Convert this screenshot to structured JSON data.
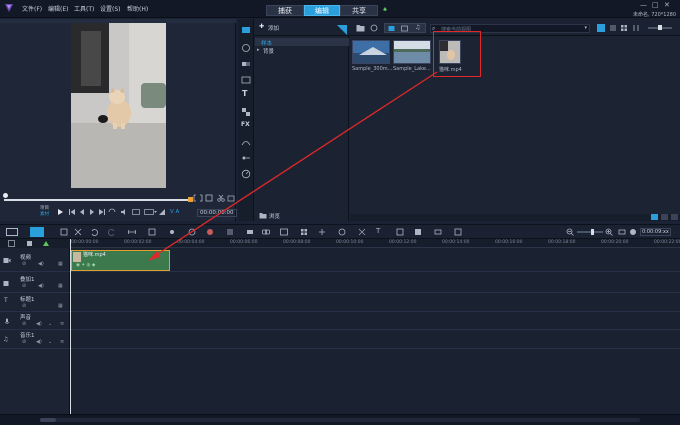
{
  "menu": {
    "items": [
      "文件(F)",
      "编辑(E)",
      "工具(T)",
      "设置(S)",
      "帮助(H)"
    ]
  },
  "tabs": [
    {
      "label": "捕获",
      "active": false
    },
    {
      "label": "编辑",
      "active": true
    },
    {
      "label": "共享",
      "active": false
    }
  ],
  "project_info": "未命名, 720*1280",
  "window_controls": {
    "minimize": "—",
    "maximize": "□",
    "close": "✕"
  },
  "preview": {
    "mode_project": "项目",
    "mode_clip": "素材",
    "timecode": "00:00:00:00",
    "ratio_label": "V A"
  },
  "library": {
    "add_label": "添加",
    "tree_items": [
      "样本",
      "背景"
    ],
    "search_placeholder": "搜索当前视图",
    "browse_label": "浏览",
    "thumbnails": [
      {
        "label": "Sample_300m..."
      },
      {
        "label": "Sample_Lake..."
      },
      {
        "label": "猫咪.mp4",
        "highlighted": true
      }
    ]
  },
  "timeline": {
    "ruler_ticks": [
      "00:00:00:00",
      "00:00:02:00",
      "00:00:04:00",
      "00:00:06:00",
      "00:00:08:00",
      "00:00:10:00",
      "00:00:12:00",
      "00:00:14:00",
      "00:00:16:00",
      "00:00:18:00",
      "00:00:20:00",
      "00:00:22:00"
    ],
    "timecode": "0:00:09:xx",
    "tracks": [
      {
        "name": "视频"
      },
      {
        "name": "叠加1"
      },
      {
        "name": "标题1"
      },
      {
        "name": "声音"
      },
      {
        "name": "音乐1"
      }
    ],
    "clip": {
      "label": "猫咪.mp4"
    }
  },
  "colors": {
    "accent": "#2b9fdc",
    "arrow": "#e02828",
    "highlight_box": "#e02828",
    "clip_fill": "#3c7a4e",
    "clip_border": "#e0a030"
  },
  "icons": [
    "app-logo-icon",
    "search-icon",
    "plus-icon",
    "play-icon",
    "scissors-icon",
    "undo-icon",
    "redo-icon",
    "zoom-in-icon",
    "zoom-out-icon",
    "speaker-icon",
    "lock-icon",
    "fx-icon",
    "text-icon",
    "folder-icon"
  ]
}
